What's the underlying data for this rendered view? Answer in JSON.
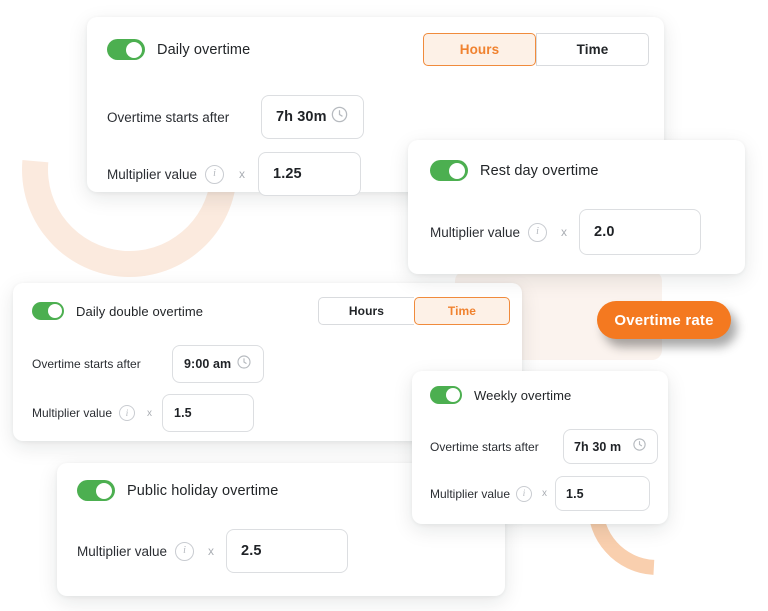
{
  "theme": {
    "accent_orange": "#f47920",
    "toggle_green": "#4caf50",
    "arc_light_peach": "#fbeade",
    "arc_peach": "#f9cfae",
    "slab_peach": "#fbf3ee"
  },
  "badge": {
    "label": "Overtime rate"
  },
  "labels": {
    "overtime_starts_after": "Overtime starts after",
    "multiplier_value": "Multiplier value",
    "times_sign": "x",
    "info_glyph": "i",
    "hours": "Hours",
    "time": "Time"
  },
  "cards": [
    {
      "id": "daily",
      "title": "Daily overtime",
      "toggle_on": true,
      "segmented": {
        "options": [
          "Hours",
          "Time"
        ],
        "selected": "Hours"
      },
      "starts_after": {
        "label": "Overtime starts after",
        "value": "7h 30m",
        "icon": "clock-icon"
      },
      "multiplier": {
        "label": "Multiplier value",
        "value": "1.25",
        "operator": "x"
      }
    },
    {
      "id": "rest-day",
      "title": "Rest day overtime",
      "toggle_on": true,
      "multiplier": {
        "label": "Multiplier value",
        "value": "2.0",
        "operator": "x"
      }
    },
    {
      "id": "daily-double",
      "title": "Daily double overtime",
      "toggle_on": true,
      "segmented": {
        "options": [
          "Hours",
          "Time"
        ],
        "selected": "Time"
      },
      "starts_after": {
        "label": "Overtime starts after",
        "value": "9:00 am",
        "icon": "clock-icon"
      },
      "multiplier": {
        "label": "Multiplier value",
        "value": "1.5",
        "operator": "x"
      }
    },
    {
      "id": "weekly",
      "title": "Weekly overtime",
      "toggle_on": true,
      "starts_after": {
        "label": "Overtime starts after",
        "value": "7h 30 m",
        "icon": "clock-icon"
      },
      "multiplier": {
        "label": "Multiplier value",
        "value": "1.5",
        "operator": "x"
      }
    },
    {
      "id": "public-holiday",
      "title": "Public holiday overtime",
      "toggle_on": true,
      "multiplier": {
        "label": "Multiplier value",
        "value": "2.5",
        "operator": "x"
      }
    }
  ]
}
